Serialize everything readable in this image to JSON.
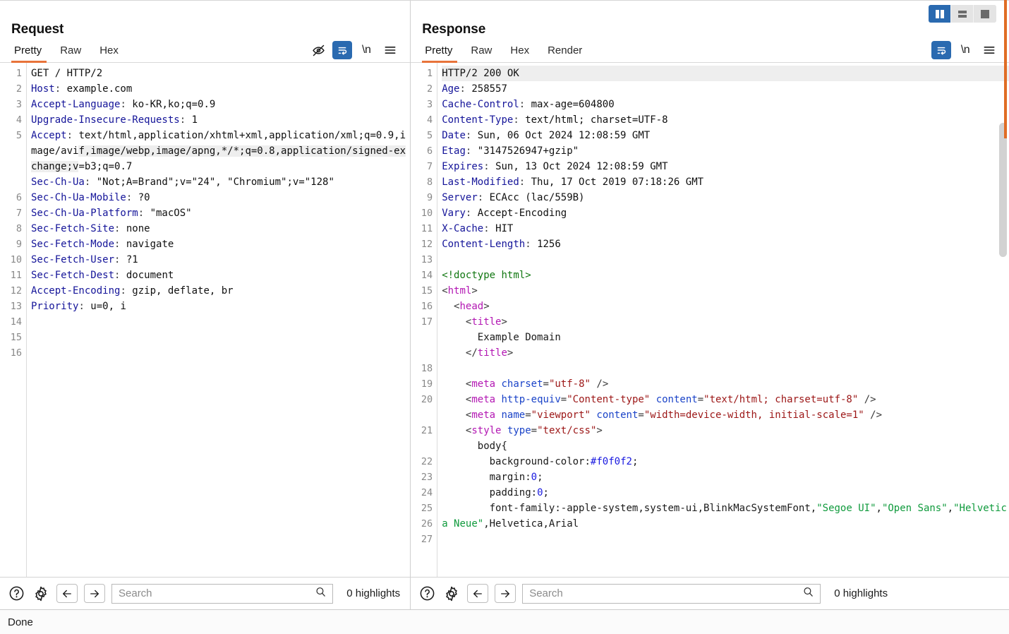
{
  "window": {
    "layout_toggle": [
      {
        "name": "vertical-split",
        "label": "Vertical split",
        "active": true
      },
      {
        "name": "horizontal-split",
        "label": "Horizontal split",
        "active": false
      },
      {
        "name": "single-pane",
        "label": "Single pane",
        "active": false
      }
    ],
    "status": "Done",
    "accent_orange": "#e8733a",
    "accent_blue": "#2a6ab0"
  },
  "request": {
    "title": "Request",
    "tabs": [
      {
        "label": "Pretty",
        "active": true
      },
      {
        "label": "Raw",
        "active": false
      },
      {
        "label": "Hex",
        "active": false
      }
    ],
    "tools": [
      {
        "name": "eye-slash-icon",
        "label": "Hide",
        "active": false
      },
      {
        "name": "word-wrap-icon",
        "label": "Word wrap",
        "active": true
      },
      {
        "name": "newline-icon",
        "label": "\\n",
        "active": false
      },
      {
        "name": "hamburger-menu-icon",
        "label": "Menu",
        "active": false
      }
    ],
    "line_numbers": [
      "1",
      "2",
      "3",
      "4",
      "5",
      "",
      "",
      "",
      "6",
      "7",
      "8",
      "9",
      "10",
      "11",
      "12",
      "13",
      "14",
      "15",
      "16"
    ],
    "lines": [
      "GET / HTTP/2",
      "Host: example.com",
      "Accept-Language: ko-KR,ko;q=0.9",
      "Upgrade-Insecure-Requests: 1",
      "Accept: text/html,application/xhtml+xml,application/xml;q=0.9,image/avif,image/webp,image/apng,*/*;q=0.8,application/signed-exchange;v=b3;q=0.7",
      "Sec-Ch-Ua: \"Not;A=Brand\";v=\"24\", \"Chromium\";v=\"128\"",
      "Sec-Ch-Ua-Mobile: ?0",
      "Sec-Ch-Ua-Platform: \"macOS\"",
      "Sec-Fetch-Site: none",
      "Sec-Fetch-Mode: navigate",
      "Sec-Fetch-User: ?1",
      "Sec-Fetch-Dest: document",
      "Accept-Encoding: gzip, deflate, br",
      "Priority: u=0, i",
      "",
      ""
    ],
    "findbar": {
      "help_label": "?",
      "search_placeholder": "Search",
      "search_value": "",
      "highlights": "0 highlights"
    }
  },
  "response": {
    "title": "Response",
    "tabs": [
      {
        "label": "Pretty",
        "active": true
      },
      {
        "label": "Raw",
        "active": false
      },
      {
        "label": "Hex",
        "active": false
      },
      {
        "label": "Render",
        "active": false
      }
    ],
    "tools": [
      {
        "name": "word-wrap-icon",
        "label": "Word wrap",
        "active": true
      },
      {
        "name": "newline-icon",
        "label": "\\n",
        "active": false
      },
      {
        "name": "hamburger-menu-icon",
        "label": "Menu",
        "active": false
      }
    ],
    "line_numbers": [
      "1",
      "2",
      "3",
      "4",
      "5",
      "6",
      "7",
      "8",
      "9",
      "10",
      "11",
      "12",
      "13",
      "14",
      "15",
      "16",
      "17",
      "",
      "",
      "18",
      "19",
      "20",
      "",
      "21",
      "",
      "22",
      "23",
      "24",
      "25",
      "26",
      "27",
      ""
    ],
    "headers": [
      "HTTP/2 200 OK",
      "Age: 258557",
      "Cache-Control: max-age=604800",
      "Content-Type: text/html; charset=UTF-8",
      "Date: Sun, 06 Oct 2024 12:08:59 GMT",
      "Etag: \"3147526947+gzip\"",
      "Expires: Sun, 13 Oct 2024 12:08:59 GMT",
      "Last-Modified: Thu, 17 Oct 2019 07:18:26 GMT",
      "Server: ECAcc (lac/559B)",
      "Vary: Accept-Encoding",
      "X-Cache: HIT",
      "Content-Length: 1256"
    ],
    "body": [
      "<!doctype html>",
      "<html>",
      "  <head>",
      "    <title>",
      "      Example Domain",
      "    </title>",
      "",
      "    <meta charset=\"utf-8\" />",
      "    <meta http-equiv=\"Content-type\" content=\"text/html; charset=utf-8\" />",
      "    <meta name=\"viewport\" content=\"width=device-width, initial-scale=1\" />",
      "    <style type=\"text/css\">",
      "      body{",
      "        background-color:#f0f0f2;",
      "        margin:0;",
      "        padding:0;",
      "        font-family:-apple-system,system-ui,BlinkMacSystemFont,\"Segoe UI\",\"Open Sans\",\"Helvetica Neue\",Helvetica,Arial"
    ],
    "findbar": {
      "help_label": "?",
      "search_placeholder": "Search",
      "search_value": "",
      "highlights": "0 highlights"
    }
  }
}
